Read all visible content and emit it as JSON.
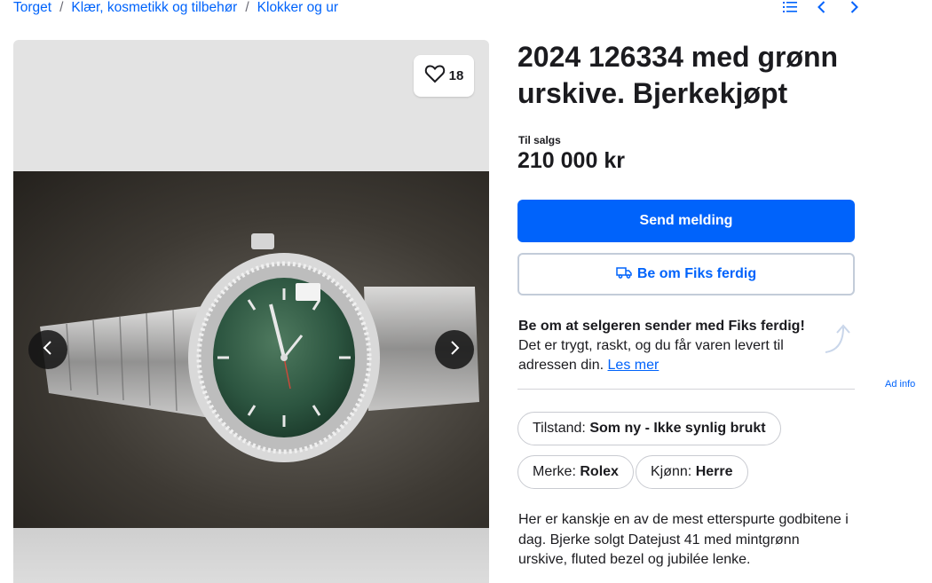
{
  "breadcrumb": [
    "Torget",
    "Klær, kosmetikk og tilbehør",
    "Klokker og ur"
  ],
  "topnav_icons": [
    "list-icon",
    "chevron-left-icon",
    "chevron-right-icon"
  ],
  "gallery": {
    "favorite_count": "18"
  },
  "listing": {
    "title": "2024 126334 med grønn urskive. Bjerkekjøpt",
    "sale_label": "Til salgs",
    "price": "210 000 kr",
    "send_message": "Send melding",
    "fiks_button": "Be om Fiks ferdig",
    "fiks_info_bold": "Be om at selgeren sender med Fiks ferdig!",
    "fiks_info_text": " Det er trygt, raskt, og du får varen levert til adressen din. ",
    "fiks_info_link": "Les mer",
    "ad_info": "Ad info"
  },
  "attributes": [
    {
      "label": "Tilstand:",
      "value": "Som ny - Ikke synlig brukt"
    },
    {
      "label": "Merke:",
      "value": "Rolex"
    },
    {
      "label": "Kjønn:",
      "value": "Herre"
    }
  ],
  "description": "Her er kanskje en av de mest etterspurte godbitene i dag. Bjerke solgt Datejust 41 med mintgrønn urskive, fluted bezel og jubilée lenke.",
  "colors": {
    "accent": "#0063fb",
    "text": "#1b1b1f"
  }
}
